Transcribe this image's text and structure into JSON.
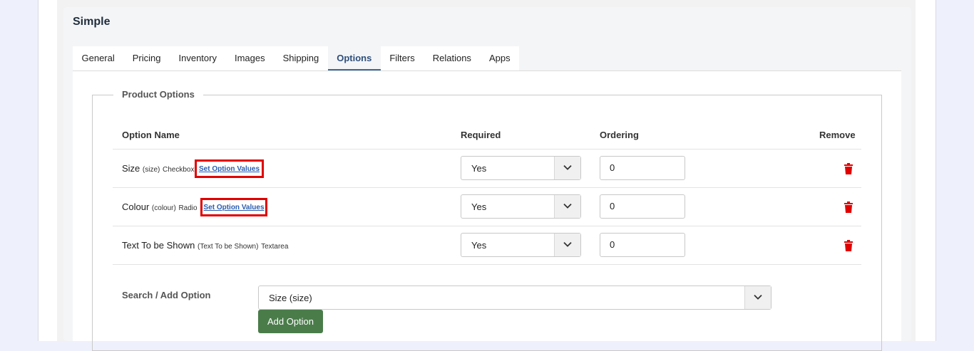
{
  "card": {
    "title": "Simple"
  },
  "tabs": [
    "General",
    "Pricing",
    "Inventory",
    "Images",
    "Shipping",
    "Options",
    "Filters",
    "Relations",
    "Apps"
  ],
  "active_tab": "Options",
  "product_options": {
    "legend": "Product Options",
    "columns": {
      "name": "Option Name",
      "required": "Required",
      "ordering": "Ordering",
      "remove": "Remove"
    },
    "rows": [
      {
        "name": "Size",
        "code": "(size)",
        "type": "Checkbox",
        "link": "Set Option Values",
        "required": "Yes",
        "ordering": "0"
      },
      {
        "name": "Colour",
        "code": "(colour)",
        "type": "Radio",
        "link": "Set Option Values",
        "required": "Yes",
        "ordering": "0"
      },
      {
        "name": "Text To be Shown",
        "code": "(Text To be Shown)",
        "type": "Textarea",
        "required": "Yes",
        "ordering": "0"
      }
    ],
    "search_label": "Search / Add Option",
    "search_value": "Size (size)",
    "add_button": "Add Option"
  },
  "colors": {
    "highlight": "#e00000",
    "trash": "#e00000",
    "add_button": "#4a7c4a",
    "active_tab": "#2d4f7c"
  }
}
